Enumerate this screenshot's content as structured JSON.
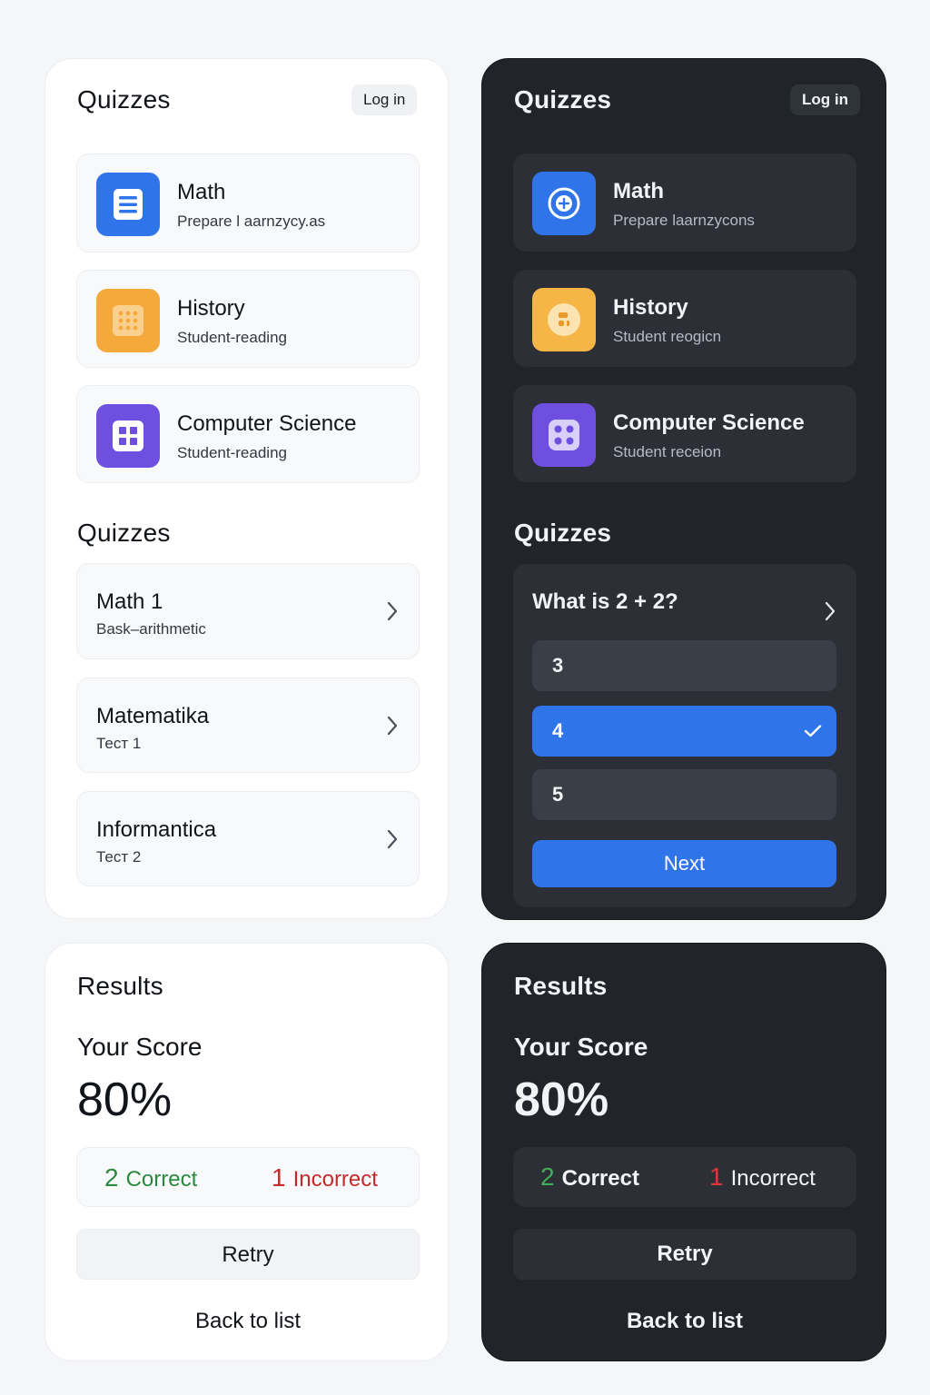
{
  "colors": {
    "accent_blue": "#2f74e8",
    "math_icon": "#2f74e8",
    "history_icon": "#f5a93b",
    "cs_icon": "#6e4fe0",
    "correct_green": "#2a8a3e",
    "incorrect_red": "#c42a2a",
    "dark_panel": "#212429",
    "light_panel": "#ffffff"
  },
  "light": {
    "home": {
      "title": "Quizzes",
      "login_label": "Log in",
      "subjects": [
        {
          "name": "Math",
          "desc": "Prepare l aarnzycy.as",
          "icon": "document-list-icon"
        },
        {
          "name": "History",
          "desc": "Student-reading",
          "icon": "grid-dots-icon"
        },
        {
          "name": "Computer Science",
          "desc": "Student-reading",
          "icon": "four-squares-icon"
        }
      ],
      "section_title": "Quizzes",
      "quizzes": [
        {
          "name": "Math 1",
          "desc": "Bask–arithmetic"
        },
        {
          "name": "Matematika",
          "desc": "Тест 1"
        },
        {
          "name": "Informantica",
          "desc": "Тест 2"
        }
      ]
    },
    "results": {
      "title": "Results",
      "score_label": "Your Score",
      "score_value": "80%",
      "correct_count": "2",
      "correct_label": "Correct",
      "incorrect_count": "1",
      "incorrect_label": "Incorrect",
      "retry_label": "Retry",
      "back_label": "Back to list"
    }
  },
  "dark": {
    "home": {
      "title": "Quizzes",
      "login_label": "Log in",
      "subjects": [
        {
          "name": "Math",
          "desc": "Prepare laarnzycons",
          "icon": "plus-circle-icon"
        },
        {
          "name": "History",
          "desc": "Student reogicn",
          "icon": "face-icon"
        },
        {
          "name": "Computer Science",
          "desc": "Student receion",
          "icon": "dice-icon"
        }
      ],
      "section_title": "Quizzes",
      "question": "What is 2 + 2?",
      "options": [
        {
          "label": "3",
          "selected": false
        },
        {
          "label": "4",
          "selected": true
        },
        {
          "label": "5",
          "selected": false
        }
      ],
      "next_label": "Next"
    },
    "results": {
      "title": "Results",
      "score_label": "Your Score",
      "score_value": "80%",
      "correct_count": "2",
      "correct_label": "Correct",
      "incorrect_count": "1",
      "incorrect_label": "Incorrect",
      "retry_label": "Retry",
      "back_label": "Back to list"
    }
  }
}
